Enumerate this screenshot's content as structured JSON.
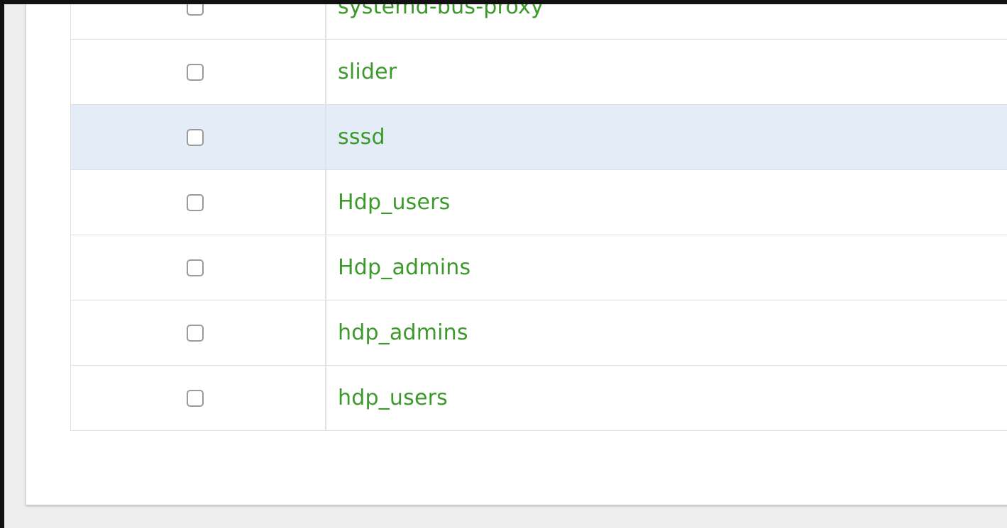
{
  "table": {
    "rows": [
      {
        "name": "systemd-bus-proxy",
        "checked": false,
        "highlighted": false
      },
      {
        "name": "slider",
        "checked": false,
        "highlighted": false
      },
      {
        "name": "sssd",
        "checked": false,
        "highlighted": true
      },
      {
        "name": "Hdp_users",
        "checked": false,
        "highlighted": false
      },
      {
        "name": "Hdp_admins",
        "checked": false,
        "highlighted": false
      },
      {
        "name": "hdp_admins",
        "checked": false,
        "highlighted": false
      },
      {
        "name": "hdp_users",
        "checked": false,
        "highlighted": false
      }
    ]
  },
  "colors": {
    "link": "#3c9a2b",
    "highlight_row": "#e3ecf7",
    "frame_border": "#111111"
  }
}
